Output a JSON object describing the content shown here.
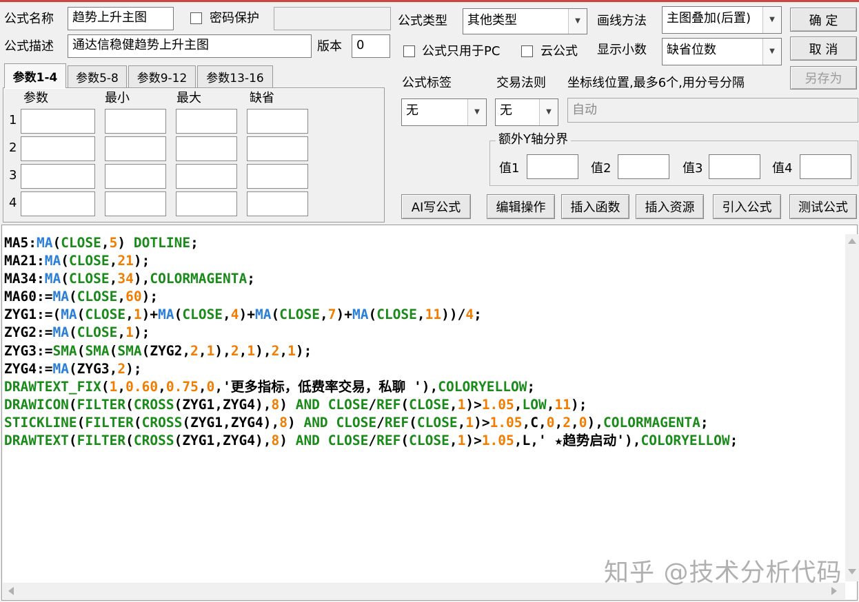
{
  "form": {
    "name_label": "公式名称",
    "name_value": "趋势上升主图",
    "password_label": "密码保护",
    "password_value": "",
    "desc_label": "公式描述",
    "desc_value": "通达信稳健趋势上升主图",
    "version_label": "版本",
    "version_value": "0",
    "type_label": "公式类型",
    "type_value": "其他类型",
    "draw_label": "画线方法",
    "draw_value": "主图叠加(后置)",
    "pc_only_label": "公式只用于PC",
    "cloud_label": "云公式",
    "decimal_label": "显示小数",
    "decimal_value": "缺省位数",
    "tag_label": "公式标签",
    "tag_value": "无",
    "rule_label": "交易法则",
    "rule_value": "无",
    "axis_label": "坐标线位置,最多6个,用分号分隔",
    "axis_value": "自动",
    "yaxis_group_label": "额外Y轴分界",
    "v1_label": "值1",
    "v2_label": "值2",
    "v3_label": "值3",
    "v4_label": "值4"
  },
  "buttons": {
    "ok": "确  定",
    "cancel": "取  消",
    "save_as": "另存为",
    "ai": "AI写公式",
    "edit": "编辑操作",
    "insert_func": "插入函数",
    "insert_res": "插入资源",
    "import": "引入公式",
    "test": "测试公式"
  },
  "tabs": [
    "参数1-4",
    "参数5-8",
    "参数9-12",
    "参数13-16"
  ],
  "params": {
    "headers": [
      "参数",
      "最小",
      "最大",
      "缺省"
    ],
    "rows": [
      "1",
      "2",
      "3",
      "4"
    ]
  },
  "code_lines": [
    [
      [
        "k",
        "MA5:"
      ],
      [
        "fn",
        "MA"
      ],
      [
        "k",
        "("
      ],
      [
        "g",
        "CLOSE"
      ],
      [
        "k",
        ","
      ],
      [
        "n",
        "5"
      ],
      [
        "k",
        ") "
      ],
      [
        "g",
        "DOTLINE"
      ],
      [
        "k",
        ";"
      ]
    ],
    [
      [
        "k",
        "MA21:"
      ],
      [
        "fn",
        "MA"
      ],
      [
        "k",
        "("
      ],
      [
        "g",
        "CLOSE"
      ],
      [
        "k",
        ","
      ],
      [
        "n",
        "21"
      ],
      [
        "k",
        ");"
      ]
    ],
    [
      [
        "k",
        "MA34:"
      ],
      [
        "fn",
        "MA"
      ],
      [
        "k",
        "("
      ],
      [
        "g",
        "CLOSE"
      ],
      [
        "k",
        ","
      ],
      [
        "n",
        "34"
      ],
      [
        "k",
        "),"
      ],
      [
        "g",
        "COLORMAGENTA"
      ],
      [
        "k",
        ";"
      ]
    ],
    [
      [
        "k",
        "MA60:="
      ],
      [
        "fn",
        "MA"
      ],
      [
        "k",
        "("
      ],
      [
        "g",
        "CLOSE"
      ],
      [
        "k",
        ","
      ],
      [
        "n",
        "60"
      ],
      [
        "k",
        ");"
      ]
    ],
    [
      [
        "k",
        "ZYG1:=("
      ],
      [
        "fn",
        "MA"
      ],
      [
        "k",
        "("
      ],
      [
        "g",
        "CLOSE"
      ],
      [
        "k",
        ","
      ],
      [
        "n",
        "1"
      ],
      [
        "k",
        ")+"
      ],
      [
        "fn",
        "MA"
      ],
      [
        "k",
        "("
      ],
      [
        "g",
        "CLOSE"
      ],
      [
        "k",
        ","
      ],
      [
        "n",
        "4"
      ],
      [
        "k",
        ")+"
      ],
      [
        "fn",
        "MA"
      ],
      [
        "k",
        "("
      ],
      [
        "g",
        "CLOSE"
      ],
      [
        "k",
        ","
      ],
      [
        "n",
        "7"
      ],
      [
        "k",
        ")+"
      ],
      [
        "fn",
        "MA"
      ],
      [
        "k",
        "("
      ],
      [
        "g",
        "CLOSE"
      ],
      [
        "k",
        ","
      ],
      [
        "n",
        "11"
      ],
      [
        "k",
        "))/"
      ],
      [
        "n",
        "4"
      ],
      [
        "k",
        ";"
      ]
    ],
    [
      [
        "k",
        "ZYG2:="
      ],
      [
        "fn",
        "MA"
      ],
      [
        "k",
        "("
      ],
      [
        "g",
        "CLOSE"
      ],
      [
        "k",
        ","
      ],
      [
        "n",
        "1"
      ],
      [
        "k",
        ");"
      ]
    ],
    [
      [
        "k",
        "ZYG3:="
      ],
      [
        "g",
        "SMA"
      ],
      [
        "k",
        "("
      ],
      [
        "g",
        "SMA"
      ],
      [
        "k",
        "("
      ],
      [
        "g",
        "SMA"
      ],
      [
        "k",
        "(ZYG2,"
      ],
      [
        "n",
        "2"
      ],
      [
        "k",
        ","
      ],
      [
        "n",
        "1"
      ],
      [
        "k",
        "),"
      ],
      [
        "n",
        "2"
      ],
      [
        "k",
        ","
      ],
      [
        "n",
        "1"
      ],
      [
        "k",
        "),"
      ],
      [
        "n",
        "2"
      ],
      [
        "k",
        ","
      ],
      [
        "n",
        "1"
      ],
      [
        "k",
        ");"
      ]
    ],
    [
      [
        "k",
        "ZYG4:="
      ],
      [
        "fn",
        "MA"
      ],
      [
        "k",
        "(ZYG3,"
      ],
      [
        "n",
        "2"
      ],
      [
        "k",
        ");"
      ]
    ],
    [
      [
        "g",
        "DRAWTEXT_FIX"
      ],
      [
        "k",
        "("
      ],
      [
        "n",
        "1"
      ],
      [
        "k",
        ","
      ],
      [
        "n",
        "0.60"
      ],
      [
        "k",
        ","
      ],
      [
        "n",
        "0.75"
      ],
      [
        "k",
        ","
      ],
      [
        "n",
        "0"
      ],
      [
        "k",
        ",'更多指标，低费率交易，私聊 '),"
      ],
      [
        "g",
        "COLORYELLOW"
      ],
      [
        "k",
        ";"
      ]
    ],
    [
      [
        "g",
        "DRAWICON"
      ],
      [
        "k",
        "("
      ],
      [
        "g",
        "FILTER"
      ],
      [
        "k",
        "("
      ],
      [
        "g",
        "CROSS"
      ],
      [
        "k",
        "(ZYG1,ZYG4),"
      ],
      [
        "n",
        "8"
      ],
      [
        "k",
        ") "
      ],
      [
        "g",
        "AND"
      ],
      [
        "k",
        " "
      ],
      [
        "g",
        "CLOSE"
      ],
      [
        "k",
        "/"
      ],
      [
        "g",
        "REF"
      ],
      [
        "k",
        "("
      ],
      [
        "g",
        "CLOSE"
      ],
      [
        "k",
        ","
      ],
      [
        "n",
        "1"
      ],
      [
        "k",
        ")>"
      ],
      [
        "n",
        "1.05"
      ],
      [
        "k",
        ","
      ],
      [
        "g",
        "LOW"
      ],
      [
        "k",
        ","
      ],
      [
        "n",
        "11"
      ],
      [
        "k",
        ");"
      ]
    ],
    [
      [
        "g",
        "STICKLINE"
      ],
      [
        "k",
        "("
      ],
      [
        "g",
        "FILTER"
      ],
      [
        "k",
        "("
      ],
      [
        "g",
        "CROSS"
      ],
      [
        "k",
        "(ZYG1,ZYG4),"
      ],
      [
        "n",
        "8"
      ],
      [
        "k",
        ") "
      ],
      [
        "g",
        "AND"
      ],
      [
        "k",
        " "
      ],
      [
        "g",
        "CLOSE"
      ],
      [
        "k",
        "/"
      ],
      [
        "g",
        "REF"
      ],
      [
        "k",
        "("
      ],
      [
        "g",
        "CLOSE"
      ],
      [
        "k",
        ","
      ],
      [
        "n",
        "1"
      ],
      [
        "k",
        ")>"
      ],
      [
        "n",
        "1.05"
      ],
      [
        "k",
        ",C,"
      ],
      [
        "n",
        "0"
      ],
      [
        "k",
        ","
      ],
      [
        "n",
        "2"
      ],
      [
        "k",
        ","
      ],
      [
        "n",
        "0"
      ],
      [
        "k",
        "),"
      ],
      [
        "g",
        "COLORMAGENTA"
      ],
      [
        "k",
        ";"
      ]
    ],
    [
      [
        "g",
        "DRAWTEXT"
      ],
      [
        "k",
        "("
      ],
      [
        "g",
        "FILTER"
      ],
      [
        "k",
        "("
      ],
      [
        "g",
        "CROSS"
      ],
      [
        "k",
        "(ZYG1,ZYG4),"
      ],
      [
        "n",
        "8"
      ],
      [
        "k",
        ") "
      ],
      [
        "g",
        "AND"
      ],
      [
        "k",
        " "
      ],
      [
        "g",
        "CLOSE"
      ],
      [
        "k",
        "/"
      ],
      [
        "g",
        "REF"
      ],
      [
        "k",
        "("
      ],
      [
        "g",
        "CLOSE"
      ],
      [
        "k",
        ","
      ],
      [
        "n",
        "1"
      ],
      [
        "k",
        ")>"
      ],
      [
        "n",
        "1.05"
      ],
      [
        "k",
        ",L,' ★趋势启动'),"
      ],
      [
        "g",
        "COLORYELLOW"
      ],
      [
        "k",
        ";"
      ]
    ]
  ],
  "watermark": "知乎 @技术分析代码",
  "colors": {
    "function": "#2b7fd6",
    "green_keyword": "#1a8a1a",
    "number": "#f07c00"
  },
  "icons": {
    "scroll_up": "triangle-up",
    "scroll_down": "triangle-down",
    "scroll_left": "triangle-left",
    "scroll_right": "triangle-right",
    "dropdown": "triangle-down"
  }
}
